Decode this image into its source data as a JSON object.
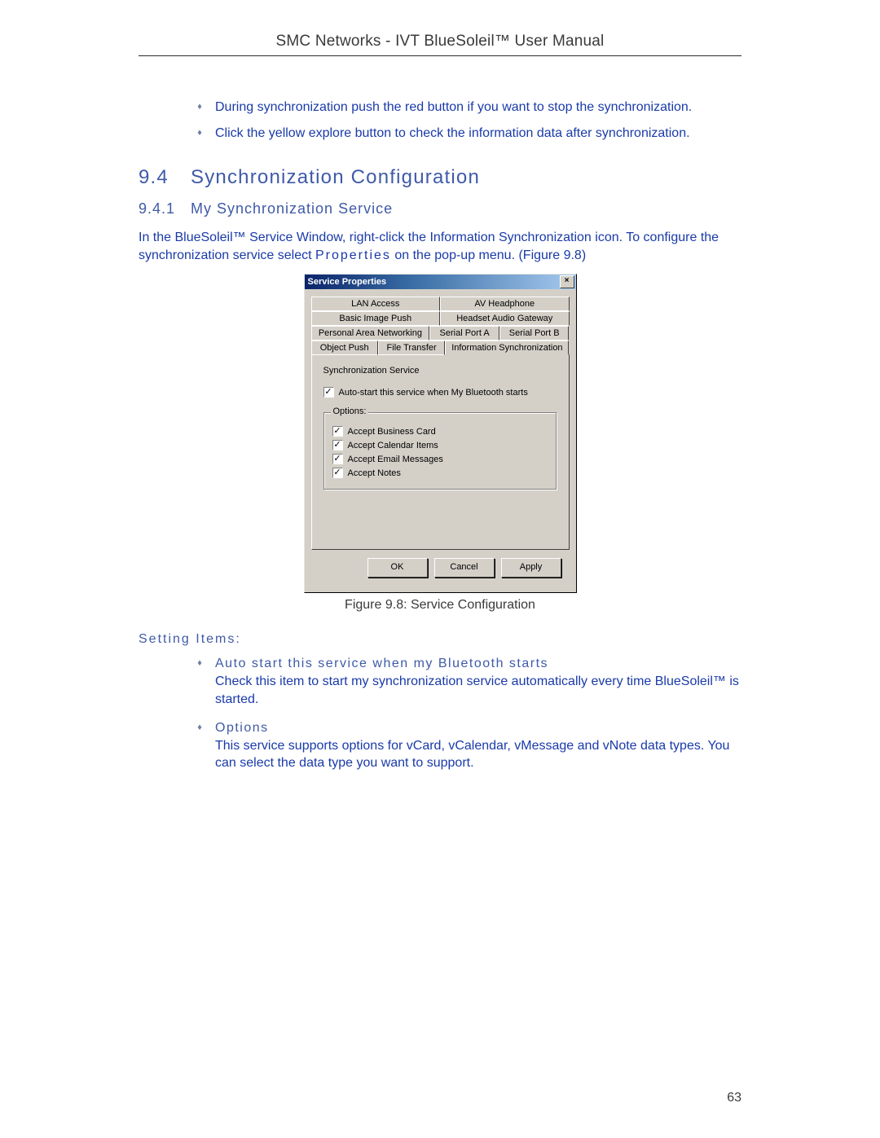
{
  "header": "SMC Networks - IVT BlueSoleil™ User Manual",
  "top_bullets": [
    "During synchronization push the red button if you want to stop the synchronization.",
    "Click the yellow explore button to check the information data after synchronization."
  ],
  "sec_num": "9.4",
  "sec_title": "Synchronization Configuration",
  "sub_num": "9.4.1",
  "sub_title": "My Synchronization Service",
  "intro_a": "In the BlueSoleil™ Service Window, right-click the Information Synchronization icon. To configure the synchronization service select ",
  "intro_prop": "Properties",
  "intro_b": " on the pop-up menu. (Figure 9.8)",
  "dialog": {
    "title": "Service Properties",
    "tabs_row1": [
      "LAN Access",
      "AV Headphone"
    ],
    "tabs_row2": [
      "Basic Image Push",
      "Headset Audio Gateway"
    ],
    "tabs_row3": [
      "Personal Area Networking",
      "Serial Port A",
      "Serial Port B"
    ],
    "tabs_row4": [
      "Object Push",
      "File Transfer",
      "Information Synchronization"
    ],
    "svc_label": "Synchronization Service",
    "autostart": "Auto-start this service when My Bluetooth starts",
    "options_legend": "Options:",
    "opt1": "Accept Business Card",
    "opt2": "Accept Calendar Items",
    "opt3": "Accept Email Messages",
    "opt4": "Accept Notes",
    "btn_ok": "OK",
    "btn_cancel": "Cancel",
    "btn_apply": "Apply"
  },
  "fig_caption": "Figure 9.8: Service Configuration",
  "setting_heading": "Setting Items:",
  "setting_items": [
    {
      "title": "Auto start this service when my Bluetooth starts",
      "body": "Check this item to start my synchronization service automatically every time BlueSoleil™ is started."
    },
    {
      "title": "Options",
      "body": "This service supports options for vCard, vCalendar, vMessage and vNote data types. You can select the data type you want to support."
    }
  ],
  "page_num": "63"
}
